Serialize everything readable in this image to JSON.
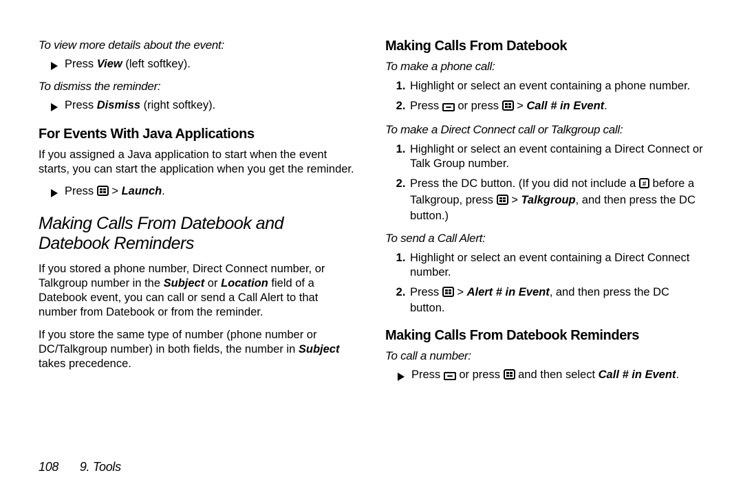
{
  "left": {
    "lead1": "To view more details about the event:",
    "b1_pre": "Press ",
    "b1_bold": "View",
    "b1_post": " (left softkey).",
    "lead2": "To dismiss the reminder:",
    "b2_pre": "Press ",
    "b2_bold": "Dismiss",
    "b2_post": " (right softkey).",
    "h3a": "For Events With Java Applications",
    "p1": "If you assigned a Java application to start when the event starts, you can start the application when you get the reminder.",
    "b3_pre": "Press ",
    "b3_gt": " > ",
    "b3_bi": "Launch",
    "b3_post": ".",
    "h2": "Making Calls From Datebook and Datebook Reminders",
    "p2a": "If you stored a phone number, Direct Connect number, or Talkgroup number in the ",
    "p2_bi1": "Subject",
    "p2b": " or ",
    "p2_bi2": "Location",
    "p2c": " field of a Datebook event, you can call or send a Call Alert to that number from Datebook or from the reminder.",
    "p3a": "If you store the same type of number (phone number or DC/Talkgroup number) in both fields, the number in ",
    "p3_bi": "Subject",
    "p3b": " takes precedence."
  },
  "right": {
    "h3a": "Making Calls From Datebook",
    "lead1": "To make a phone call:",
    "li1": "Highlight or select an event containing a phone number.",
    "li2_pre": "Press ",
    "li2_mid": " or press ",
    "li2_gt": " > ",
    "li2_bi": "Call # in Event",
    "li2_post": ".",
    "lead2": "To make a Direct Connect call or Talkgroup call:",
    "li3": "Highlight or select an event containing a Direct Connect or Talk Group number.",
    "li4a": "Press the DC button. (If you did not include a ",
    "li4b": " before a Talkgroup, press ",
    "li4_gt": " > ",
    "li4_bi": "Talkgroup",
    "li4c": ", and then press the DC button.)",
    "lead3": "To send a Call Alert:",
    "li5": "Highlight or select an event containing a Direct Connect number.",
    "li6_pre": "Press ",
    "li6_gt": " > ",
    "li6_bi": "Alert # in Event",
    "li6_post": ", and then press the DC button.",
    "h3b": "Making Calls From Datebook Reminders",
    "lead4": "To call a number:",
    "b4_pre": "Press ",
    "b4_mid": " or press ",
    "b4_post": " and then select ",
    "b4_bi": "Call # in Event",
    "b4_end": "."
  },
  "footer": {
    "page": "108",
    "section": "9. Tools"
  },
  "icons": {
    "menu": "menu-key-icon",
    "ok": "ok-key-icon",
    "hash": "hash-key-icon",
    "bullet": "play-bullet-icon"
  }
}
